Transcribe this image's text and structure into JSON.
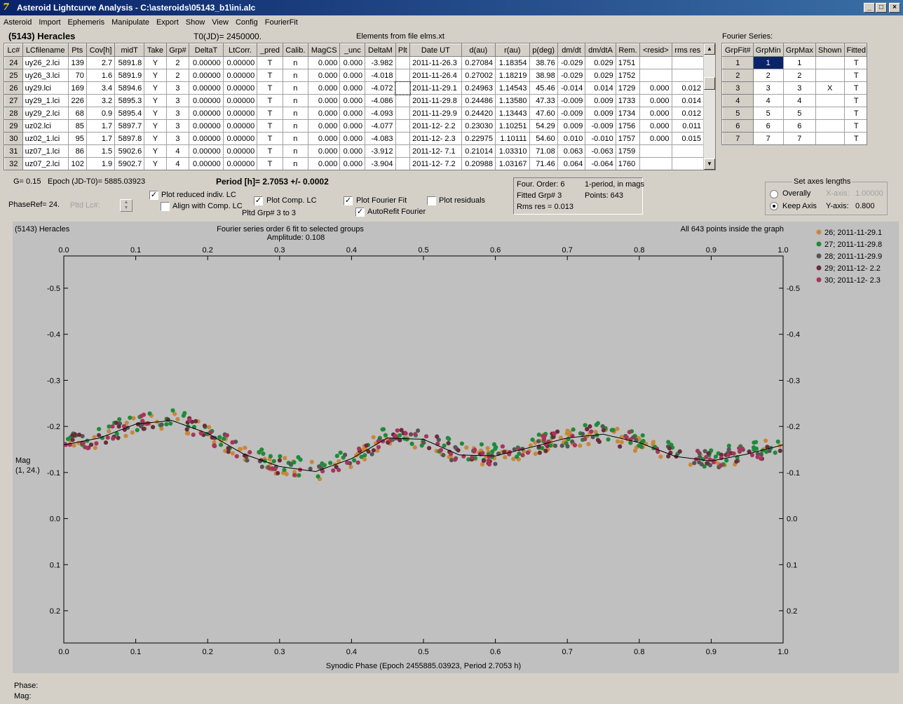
{
  "window": {
    "title": "Asteroid Lightcurve Analysis - C:\\asteroids\\05143_b1\\ini.alc",
    "min": "_",
    "max": "□",
    "close": "×"
  },
  "menu": [
    "Asteroid",
    "Import",
    "Ephemeris",
    "Manipulate",
    "Export",
    "Show",
    "View",
    "Config",
    "FourierFit"
  ],
  "header": {
    "object": "(5143) Heracles",
    "t0": "T0(JD)= 2450000.",
    "elements": "Elements from file elms.xt",
    "fourier_label": "Fourier Series:"
  },
  "lc_table": {
    "columns": [
      "Lc#",
      "LCfilename",
      "Pts",
      "Cov[h]",
      "midT",
      "Take",
      "Grp#",
      "DeltaT",
      "LtCorr.",
      "_pred",
      "Calib.",
      "MagCS",
      "_unc",
      "DeltaM",
      "Plt",
      "Date UT",
      "d(au)",
      "r(au)",
      "p(deg)",
      "dm/dt",
      "dm/dtA",
      "Rem.",
      "<resid>",
      "rms res"
    ],
    "rows": [
      [
        "24",
        "uy26_2.lci",
        "139",
        "2.7",
        "5891.8",
        "Y",
        "2",
        "0.00000",
        "0.00000",
        "T",
        "n",
        "0.000",
        "0.000",
        "-3.982",
        "",
        "2011-11-26.3",
        "0.27084",
        "1.18354",
        "38.76",
        "-0.029",
        "0.029",
        "1751",
        "",
        ""
      ],
      [
        "25",
        "uy26_3.lci",
        "70",
        "1.6",
        "5891.9",
        "Y",
        "2",
        "0.00000",
        "0.00000",
        "T",
        "n",
        "0.000",
        "0.000",
        "-4.018",
        "",
        "2011-11-26.4",
        "0.27002",
        "1.18219",
        "38.98",
        "-0.029",
        "0.029",
        "1752",
        "",
        ""
      ],
      [
        "26",
        "uy29.lci",
        "169",
        "3.4",
        "5894.6",
        "Y",
        "3",
        "0.00000",
        "0.00000",
        "T",
        "n",
        "0.000",
        "0.000",
        "-4.072",
        "",
        "2011-11-29.1",
        "0.24963",
        "1.14543",
        "45.46",
        "-0.014",
        "0.014",
        "1729",
        "0.000",
        "0.012"
      ],
      [
        "27",
        "uy29_1.lci",
        "226",
        "3.2",
        "5895.3",
        "Y",
        "3",
        "0.00000",
        "0.00000",
        "T",
        "n",
        "0.000",
        "0.000",
        "-4.086",
        "",
        "2011-11-29.8",
        "0.24486",
        "1.13580",
        "47.33",
        "-0.009",
        "0.009",
        "1733",
        "0.000",
        "0.014"
      ],
      [
        "28",
        "uy29_2.lci",
        "68",
        "0.9",
        "5895.4",
        "Y",
        "3",
        "0.00000",
        "0.00000",
        "T",
        "n",
        "0.000",
        "0.000",
        "-4.093",
        "",
        "2011-11-29.9",
        "0.24420",
        "1.13443",
        "47.60",
        "-0.009",
        "0.009",
        "1734",
        "0.000",
        "0.012"
      ],
      [
        "29",
        "uz02.lci",
        "85",
        "1.7",
        "5897.7",
        "Y",
        "3",
        "0.00000",
        "0.00000",
        "T",
        "n",
        "0.000",
        "0.000",
        "-4.077",
        "",
        "2011-12- 2.2",
        "0.23030",
        "1.10251",
        "54.29",
        "0.009",
        "-0.009",
        "1756",
        "0.000",
        "0.011"
      ],
      [
        "30",
        "uz02_1.lci",
        "95",
        "1.7",
        "5897.8",
        "Y",
        "3",
        "0.00000",
        "0.00000",
        "T",
        "n",
        "0.000",
        "0.000",
        "-4.083",
        "",
        "2011-12- 2.3",
        "0.22975",
        "1.10111",
        "54.60",
        "0.010",
        "-0.010",
        "1757",
        "0.000",
        "0.015"
      ],
      [
        "31",
        "uz07_1.lci",
        "86",
        "1.5",
        "5902.6",
        "Y",
        "4",
        "0.00000",
        "0.00000",
        "T",
        "n",
        "0.000",
        "0.000",
        "-3.912",
        "",
        "2011-12- 7.1",
        "0.21014",
        "1.03310",
        "71.08",
        "0.063",
        "-0.063",
        "1759",
        "",
        ""
      ],
      [
        "32",
        "uz07_2.lci",
        "102",
        "1.9",
        "5902.7",
        "Y",
        "4",
        "0.00000",
        "0.00000",
        "T",
        "n",
        "0.000",
        "0.000",
        "-3.904",
        "",
        "2011-12- 7.2",
        "0.20988",
        "1.03167",
        "71.46",
        "0.064",
        "-0.064",
        "1760",
        "",
        ""
      ]
    ]
  },
  "fourier_table": {
    "columns": [
      "GrpFit#",
      "GrpMin",
      "GrpMax",
      "Shown",
      "Fitted"
    ],
    "rows": [
      [
        "1",
        "1",
        "1",
        "",
        "T"
      ],
      [
        "2",
        "2",
        "2",
        "",
        "T"
      ],
      [
        "3",
        "3",
        "3",
        "X",
        "T"
      ],
      [
        "4",
        "4",
        "4",
        "",
        "T"
      ],
      [
        "5",
        "5",
        "5",
        "",
        "T"
      ],
      [
        "6",
        "6",
        "6",
        "",
        "T"
      ],
      [
        "7",
        "7",
        "7",
        "",
        "T"
      ]
    ]
  },
  "controls": {
    "g": "G= 0.15",
    "epoch": "Epoch (JD-T0)= 5885.03923",
    "period": "Period [h]= 2.7053 +/- 0.0002",
    "phaseref": "PhaseRef= 24.",
    "pltd_lc": "Pltd Lc#:",
    "plot_reduced": "Plot reduced indiv. LC",
    "align_comp": "Align with Comp. LC",
    "plot_comp": "Plot Comp. LC",
    "pltd_grp": "Pltd Grp#  3   to   3",
    "plot_fourier": "Plot Fourier Fit",
    "autorefit": "AutoRefit Fourier",
    "plot_resid": "Plot residuals",
    "four_order": "Four. Order:  6",
    "fitted_grp": "Fitted Grp# 3",
    "rms_res": "Rms res     = 0.013",
    "one_period": "1-period, in mags",
    "points": "Points: 643",
    "axes_title": "Set axes lengths",
    "overally": "Overally",
    "keep_axis": "Keep Axis",
    "x_axis_label": "X-axis:",
    "x_axis_val": "1.00000",
    "y_axis_label": "Y-axis:",
    "y_axis_val": "0.800"
  },
  "chart_data": {
    "type": "scatter",
    "title": "Fourier series order 6 fit to selected groups",
    "subtitle": "Amplitude: 0.108",
    "object_label": "(5143) Heracles",
    "inside_label": "All 643 points inside the graph",
    "xlabel": "Synodic Phase (Epoch 2455885.03923, Period 2.7053 h)",
    "ylabel": "Mag",
    "ylabel2": "(1, 24.)",
    "xlim": [
      0.0,
      1.0
    ],
    "ylim": [
      0.27,
      -0.57
    ],
    "x_ticks": [
      "0.0",
      "0.1",
      "0.2",
      "0.3",
      "0.4",
      "0.5",
      "0.6",
      "0.7",
      "0.8",
      "0.9",
      "1.0"
    ],
    "y_ticks": [
      "-0.5",
      "-0.4",
      "-0.3",
      "-0.2",
      "-0.1",
      "0.0",
      "0.1",
      "0.2"
    ],
    "y_tick_values": [
      -0.5,
      -0.4,
      -0.3,
      -0.2,
      -0.1,
      0.0,
      0.1,
      0.2
    ],
    "fit_curve": {
      "x": [
        0.0,
        0.05,
        0.1,
        0.15,
        0.2,
        0.25,
        0.3,
        0.35,
        0.4,
        0.45,
        0.5,
        0.55,
        0.6,
        0.65,
        0.7,
        0.75,
        0.8,
        0.85,
        0.9,
        0.95,
        1.0
      ],
      "y": [
        -0.16,
        -0.175,
        -0.205,
        -0.213,
        -0.185,
        -0.14,
        -0.113,
        -0.102,
        -0.13,
        -0.175,
        -0.172,
        -0.138,
        -0.136,
        -0.155,
        -0.175,
        -0.183,
        -0.165,
        -0.135,
        -0.125,
        -0.14,
        -0.16
      ]
    },
    "series": [
      {
        "name": "26; 2011-11-29.1",
        "color": "#c8873a"
      },
      {
        "name": "27; 2011-11-29.8",
        "color": "#1e8b3a"
      },
      {
        "name": "28; 2011-11-29.9",
        "color": "#555555"
      },
      {
        "name": "29; 2011-12- 2.2",
        "color": "#6b2b3a"
      },
      {
        "name": "30; 2011-12- 2.3",
        "color": "#a8345a"
      }
    ],
    "points_per_series": [
      169,
      226,
      68,
      85,
      95
    ]
  },
  "status": {
    "phase": "Phase:",
    "mag": "Mag:"
  }
}
